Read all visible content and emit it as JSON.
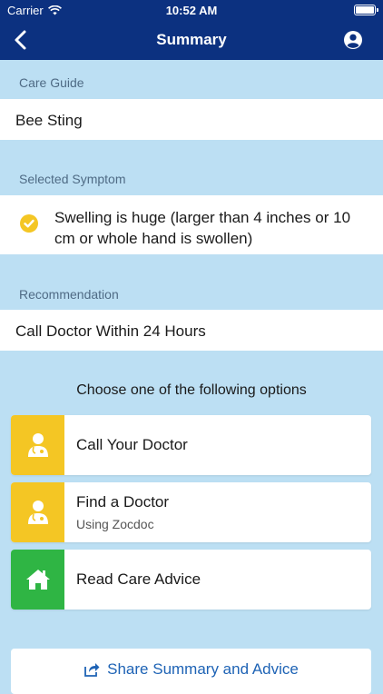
{
  "status_bar": {
    "carrier": "Carrier",
    "time": "10:52 AM"
  },
  "nav": {
    "title": "Summary"
  },
  "care_guide": {
    "label": "Care Guide",
    "value": "Bee Sting"
  },
  "symptom": {
    "label": "Selected Symptom",
    "value": "Swelling is huge (larger than 4 inches or 10 cm or whole hand is swollen)"
  },
  "recommendation": {
    "label": "Recommendation",
    "value": "Call Doctor Within 24 Hours"
  },
  "options_heading": "Choose one of the following options",
  "options": [
    {
      "label": "Call Your Doctor",
      "color": "#f4c624",
      "icon": "doctor-icon"
    },
    {
      "label": "Find a Doctor",
      "sub": "Using Zocdoc",
      "color": "#f4c624",
      "icon": "doctor-icon"
    },
    {
      "label": "Read Care Advice",
      "color": "#2fb544",
      "icon": "home-icon"
    }
  ],
  "share": {
    "label": "Share Summary and Advice"
  },
  "colors": {
    "nav": "#0c3180",
    "background": "#bcdff3",
    "accent_yellow": "#f4c624",
    "accent_green": "#2fb544",
    "link_blue": "#1e63b5"
  }
}
